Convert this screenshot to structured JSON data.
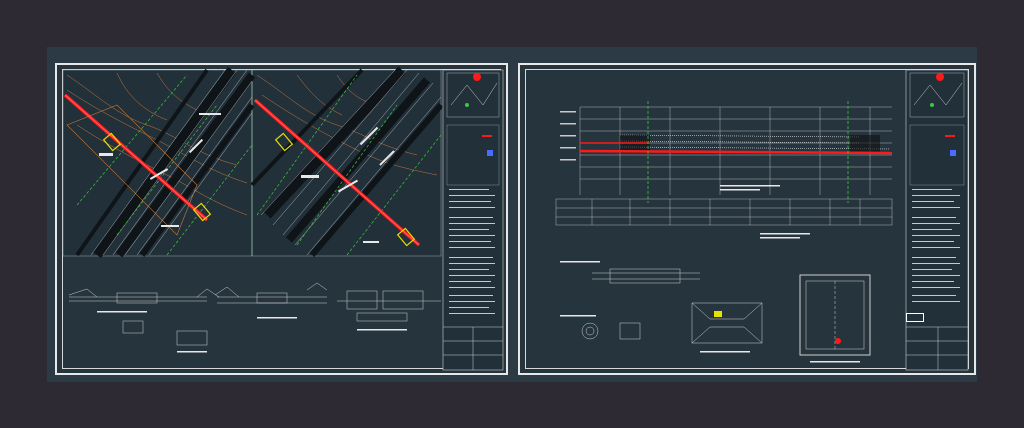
{
  "viewport": {
    "name": "cad-model-space"
  },
  "sheets": [
    {
      "id": "left",
      "name": "drawing-sheet-plan"
    },
    {
      "id": "right",
      "name": "drawing-sheet-profile"
    }
  ],
  "colors": {
    "background": "#2e2a33",
    "canvas": "#2b3a44",
    "sheet_border": "#e8e8e8",
    "pipeline": "#ff1a1a",
    "grid_green": "#3cc83c",
    "highlight_yellow": "#e8e000",
    "contour": "#c87a3c",
    "linework": "#d0d0d0"
  }
}
